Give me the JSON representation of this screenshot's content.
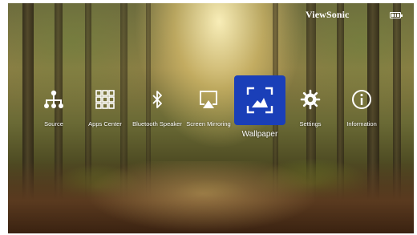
{
  "header": {
    "brand": "ViewSonic",
    "battery_icon": "battery-icon"
  },
  "menu": {
    "items": [
      {
        "label": "Source",
        "icon": "source-tree-icon",
        "selected": false
      },
      {
        "label": "Apps Center",
        "icon": "grid-icon",
        "selected": false
      },
      {
        "label": "Bluetooth Speaker",
        "icon": "bluetooth-icon",
        "selected": false
      },
      {
        "label": "Screen Mirroring",
        "icon": "screen-mirroring-icon",
        "selected": false
      },
      {
        "label": "Wallpaper",
        "icon": "wallpaper-icon",
        "selected": true
      },
      {
        "label": "Settings",
        "icon": "gear-icon",
        "selected": false
      },
      {
        "label": "Information",
        "icon": "info-icon",
        "selected": false
      }
    ]
  },
  "colors": {
    "selected_tile": "#1a3fb8",
    "text": "#ffffff"
  }
}
